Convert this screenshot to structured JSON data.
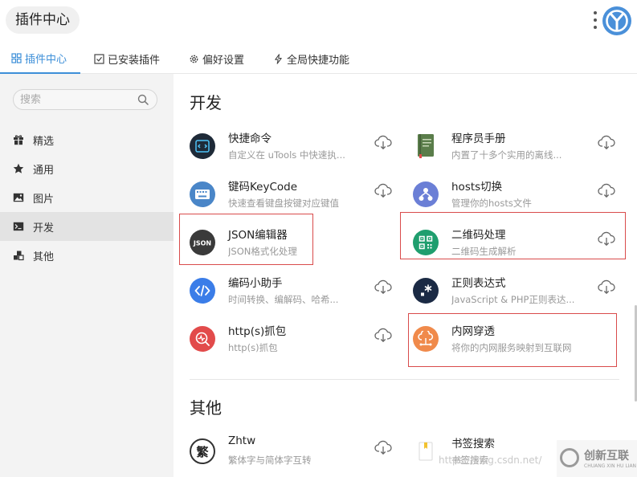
{
  "header": {
    "title": "插件中心"
  },
  "tabs": [
    {
      "label": "插件中心",
      "icon": "grid-icon",
      "active": true
    },
    {
      "label": "已安装插件",
      "icon": "check-square-icon",
      "active": false
    },
    {
      "label": "偏好设置",
      "icon": "gear-icon",
      "active": false
    },
    {
      "label": "全局快捷功能",
      "icon": "lightning-icon",
      "active": false
    }
  ],
  "search": {
    "placeholder": "搜索"
  },
  "sidebar": {
    "items": [
      {
        "label": "精选",
        "icon": "gift-icon",
        "active": false
      },
      {
        "label": "通用",
        "icon": "star-icon",
        "active": false
      },
      {
        "label": "图片",
        "icon": "image-icon",
        "active": false
      },
      {
        "label": "开发",
        "icon": "terminal-icon",
        "active": true
      },
      {
        "label": "其他",
        "icon": "blocks-icon",
        "active": false
      }
    ]
  },
  "sections": [
    {
      "title": "开发",
      "plugins": [
        {
          "name": "快捷命令",
          "desc": "自定义在 uTools 中快速执...",
          "icon": "code-terminal-icon",
          "color": "#1e2a38"
        },
        {
          "name": "程序员手册",
          "desc": "内置了十多个实用的离线...",
          "icon": "book-icon",
          "color": "#5a7d4a"
        },
        {
          "name": "键码KeyCode",
          "desc": "快速查看键盘按键对应键值",
          "icon": "keyboard-icon",
          "color": "#4a86c8"
        },
        {
          "name": "hosts切换",
          "desc": "管理你的hosts文件",
          "icon": "hosts-icon",
          "color": "#6b7fd6"
        },
        {
          "name": "JSON编辑器",
          "desc": "JSON格式化处理",
          "icon": "json-icon",
          "color": "#3a3a3a"
        },
        {
          "name": "二维码处理",
          "desc": "二维码生成解析",
          "icon": "qrcode-icon",
          "color": "#1f9e6e"
        },
        {
          "name": "编码小助手",
          "desc": "时间转换、编解码、哈希...",
          "icon": "code-brackets-icon",
          "color": "#3b7de8"
        },
        {
          "name": "正则表达式",
          "desc": "JavaScript & PHP正则表达...",
          "icon": "regex-icon",
          "color": "#1b2a44"
        },
        {
          "name": "http(s)抓包",
          "desc": "http(s)抓包",
          "icon": "http-capture-icon",
          "color": "#e24b4b"
        },
        {
          "name": "内网穿透",
          "desc": "将你的内网服务映射到互联网",
          "icon": "cloud-network-icon",
          "color": "#f08a4b"
        }
      ]
    },
    {
      "title": "其他",
      "plugins": [
        {
          "name": "Zhtw",
          "desc": "繁体字与简体字互转",
          "icon": "traditional-char-icon",
          "glyph": "繁",
          "color": "#ffffff"
        },
        {
          "name": "书签搜索",
          "desc": "书签搜索",
          "icon": "bookmark-icon",
          "color": "#ffffff"
        }
      ]
    }
  ],
  "watermark": {
    "text": "https://blog.csdn.net/",
    "brand": "创新互联",
    "brand_sub": "CHUANG XIN HU LIAN"
  }
}
